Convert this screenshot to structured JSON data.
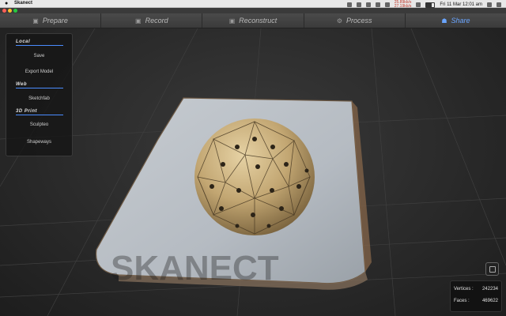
{
  "menubar": {
    "apple": "",
    "app_name": "Skanect",
    "status_red_1": "25.89kb/s",
    "status_red_2": "27.19kb/s",
    "datetime": "Fri 11 Mar  12:01 am"
  },
  "tabs": [
    {
      "icon": "▣",
      "label": "Prepare"
    },
    {
      "icon": "▣",
      "label": "Record"
    },
    {
      "icon": "▣",
      "label": "Reconstruct"
    },
    {
      "icon": "⚙",
      "label": "Process"
    },
    {
      "icon": "☗",
      "label": "Share",
      "active": true
    }
  ],
  "panel": {
    "local_title": "Local",
    "save": "Save",
    "export_model": "Export Model",
    "web_title": "Web",
    "sketchfab": "Sketchfab",
    "print_title": "3D Print",
    "sculpteo": "Sculpteo",
    "shapeways": "Shapeways"
  },
  "watermark": "SKANECT",
  "stats": {
    "vertices_label": "Vertices :",
    "vertices_value": "242234",
    "faces_label": "Faces :",
    "faces_value": "469622"
  },
  "colors": {
    "accent": "#4a8cff",
    "active_tab": "#6aa5ff",
    "surface": "#c9cdd2",
    "sphere": "#c8ad7a"
  }
}
